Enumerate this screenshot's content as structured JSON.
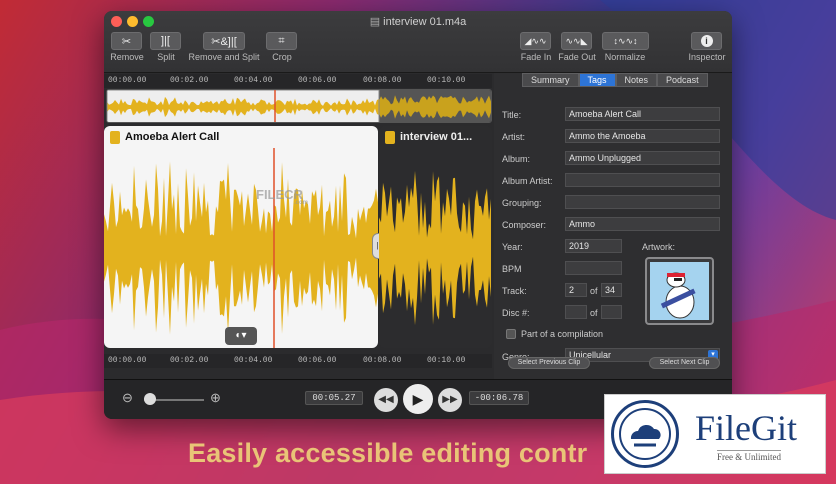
{
  "window": {
    "title": "interview 01.m4a"
  },
  "toolbar": {
    "remove": {
      "icon": "scissors-icon",
      "label": "Remove"
    },
    "split": {
      "icon": "split-icon",
      "label": "Split"
    },
    "remove_split": {
      "icon": "remove-split-icon",
      "label": "Remove and Split"
    },
    "crop": {
      "icon": "crop-icon",
      "label": "Crop"
    },
    "fade_in": {
      "icon": "fade-in-icon",
      "label": "Fade In"
    },
    "fade_out": {
      "icon": "fade-out-icon",
      "label": "Fade Out"
    },
    "normalize": {
      "icon": "normalize-icon",
      "label": "Normalize"
    },
    "inspector": {
      "icon": "info-icon",
      "label": "Inspector"
    }
  },
  "timeline": {
    "ticks": [
      "00:00.00",
      "00:02.00",
      "00:04.00",
      "00:06.00",
      "00:08.00",
      "00:10.00"
    ]
  },
  "clips": {
    "a": {
      "title": "Amoeba Alert Call"
    },
    "b": {
      "title": "interview 01..."
    }
  },
  "watermark": {
    "text": "FILECR",
    "sub": ".com"
  },
  "inspector": {
    "tabs": [
      "Summary",
      "Tags",
      "Notes",
      "Podcast"
    ],
    "active_tab": "Tags",
    "labels": {
      "title": "Title:",
      "artist": "Artist:",
      "album": "Album:",
      "album_artist": "Album Artist:",
      "grouping": "Grouping:",
      "composer": "Composer:",
      "year": "Year:",
      "bpm": "BPM",
      "track": "Track:",
      "disc": "Disc #:",
      "of": "of",
      "artwork": "Artwork:",
      "genre": "Genre:"
    },
    "values": {
      "title": "Amoeba Alert Call",
      "artist": "Ammo the Amoeba",
      "album": "Ammo Unplugged",
      "album_artist": "",
      "grouping": "",
      "composer": "Ammo",
      "year": "2019",
      "bpm": "",
      "track": "2",
      "track_of": "34",
      "disc": "",
      "disc_of": "",
      "genre": "Unicellular"
    },
    "compilation_label": "Part of a compilation",
    "compilation_checked": false,
    "prev_clip": "Select Previous Clip",
    "next_clip": "Select Next Clip"
  },
  "transport": {
    "current_time": "00:05.27",
    "remaining_time": "-00:06.78",
    "zoom_level": 0.1
  },
  "caption": "Easily accessible editing contr",
  "logo": {
    "name": "FileGit",
    "tagline": "Free & Unlimited"
  },
  "colors": {
    "wave": "#e3b21e",
    "playhead": "#e0502a",
    "accent": "#2d74d6"
  }
}
